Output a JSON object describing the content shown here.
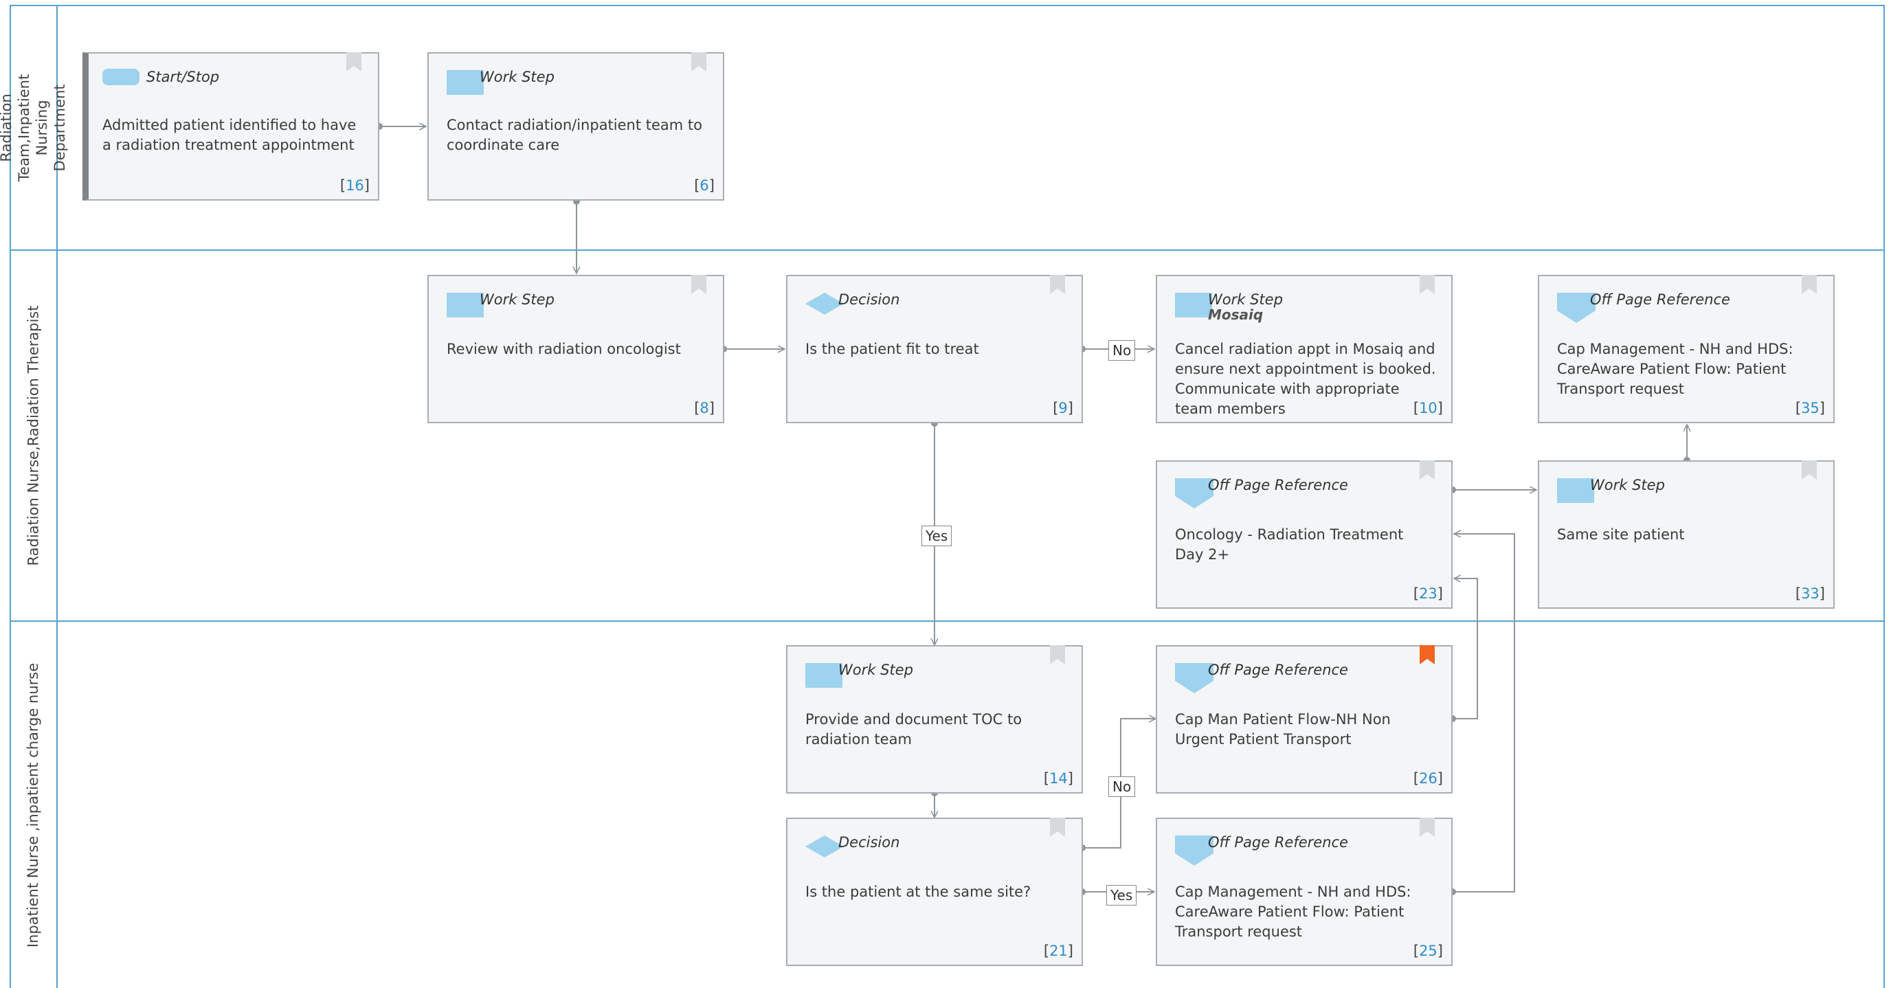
{
  "lanes": [
    {
      "label": "Radiation Team,Inpatient Nursing Department"
    },
    {
      "label": "Radiation Nurse,Radiation Therapist"
    },
    {
      "label": "Inpatient Nurse ,inpatient charge nurse"
    }
  ],
  "colors": {
    "lane_border": "#5aa2cf",
    "shape_fill": "#9dd3ee",
    "ref_number": "#2f8ccc",
    "bookmark_gray": "#d6dadd",
    "bookmark_active": "#f26522",
    "connector": "#8f959a"
  },
  "nodes": {
    "n16": {
      "type": "Start/Stop",
      "text": "Admitted patient identified to have a radiation treatment appointment",
      "ref": "16",
      "icon": "start-stop-icon"
    },
    "n6": {
      "type": "Work Step",
      "text": "Contact radiation/inpatient team to coordinate care",
      "ref": "6",
      "icon": "work-step-icon"
    },
    "n8": {
      "type": "Work Step",
      "text": "Review with radiation oncologist",
      "ref": "8",
      "icon": "work-step-icon"
    },
    "n9": {
      "type": "Decision",
      "text": "Is the patient fit to treat",
      "ref": "9",
      "icon": "decision-icon"
    },
    "n10": {
      "type": "Work Step",
      "system": "Mosaiq",
      "text": "Cancel radiation appt in Mosaiq and ensure next appointment is booked. Communicate with appropriate team members",
      "ref": "10",
      "icon": "work-step-icon"
    },
    "n35": {
      "type": "Off Page Reference",
      "text": "Cap Management - NH and HDS: CareAware Patient Flow:  Patient Transport request",
      "ref": "35",
      "icon": "off-page-reference-icon"
    },
    "n23": {
      "type": "Off Page Reference",
      "text": "Oncology - Radiation Treatment Day 2+",
      "ref": "23",
      "icon": "off-page-reference-icon"
    },
    "n33": {
      "type": "Work Step",
      "text": "Same site patient",
      "ref": "33",
      "icon": "work-step-icon"
    },
    "n14": {
      "type": "Work Step",
      "text": "Provide and document TOC to radiation team",
      "ref": "14",
      "icon": "work-step-icon"
    },
    "n26": {
      "type": "Off Page Reference",
      "text": "Cap Man Patient Flow-NH Non Urgent Patient Transport",
      "ref": "26",
      "icon": "off-page-reference-icon",
      "bookmarked": true
    },
    "n21": {
      "type": "Decision",
      "text": "Is the patient at the same site?",
      "ref": "21",
      "icon": "decision-icon"
    },
    "n25": {
      "type": "Off Page Reference",
      "text": "Cap Management - NH and HDS: CareAware Patient Flow:  Patient Transport request",
      "ref": "25",
      "icon": "off-page-reference-icon"
    }
  },
  "connector_labels": {
    "no_9": "No",
    "yes_9": "Yes",
    "no_21": "No",
    "yes_21": "Yes"
  }
}
